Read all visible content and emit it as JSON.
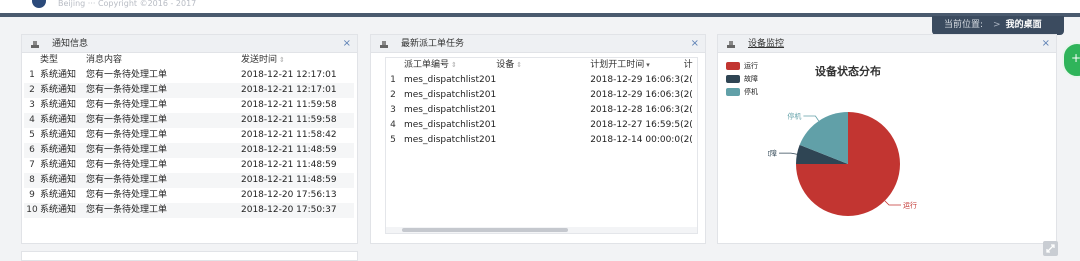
{
  "header": {
    "copyright": "Beijing ··· Copyright ©2016 - 2017",
    "breadcrumb_label": "当前位置:",
    "breadcrumb_sep": ">",
    "breadcrumb_current": "我的桌面"
  },
  "notice": {
    "title": "通知信息",
    "close": "×",
    "columns": [
      "类型",
      "消息内容",
      "发送时间"
    ],
    "rows": [
      {
        "n": "1",
        "type": "系统通知",
        "msg": "您有一条待处理工单",
        "time": "2018-12-21 12:17:01"
      },
      {
        "n": "2",
        "type": "系统通知",
        "msg": "您有一条待处理工单",
        "time": "2018-12-21 12:17:01"
      },
      {
        "n": "3",
        "type": "系统通知",
        "msg": "您有一条待处理工单",
        "time": "2018-12-21 11:59:58"
      },
      {
        "n": "4",
        "type": "系统通知",
        "msg": "您有一条待处理工单",
        "time": "2018-12-21 11:59:58"
      },
      {
        "n": "5",
        "type": "系统通知",
        "msg": "您有一条待处理工单",
        "time": "2018-12-21 11:58:42"
      },
      {
        "n": "6",
        "type": "系统通知",
        "msg": "您有一条待处理工单",
        "time": "2018-12-21 11:48:59"
      },
      {
        "n": "7",
        "type": "系统通知",
        "msg": "您有一条待处理工单",
        "time": "2018-12-21 11:48:59"
      },
      {
        "n": "8",
        "type": "系统通知",
        "msg": "您有一条待处理工单",
        "time": "2018-12-21 11:48:59"
      },
      {
        "n": "9",
        "type": "系统通知",
        "msg": "您有一条待处理工单",
        "time": "2018-12-20 17:56:13"
      },
      {
        "n": "10",
        "type": "系统通知",
        "msg": "您有一条待处理工单",
        "time": "2018-12-20 17:50:37"
      }
    ]
  },
  "dispatch": {
    "title": "最新派工单任务",
    "close": "×",
    "columns": [
      "派工单编号",
      "设备",
      "计划开工时间",
      "计"
    ],
    "rows": [
      {
        "n": "1",
        "code": "mes_dispatchlist201",
        "device": "",
        "time": "2018-12-29 16:06:3(",
        "extra": "2("
      },
      {
        "n": "2",
        "code": "mes_dispatchlist201",
        "device": "",
        "time": "2018-12-29 16:06:3(",
        "extra": "2("
      },
      {
        "n": "3",
        "code": "mes_dispatchlist201",
        "device": "",
        "time": "2018-12-28 16:06:3(",
        "extra": "2("
      },
      {
        "n": "4",
        "code": "mes_dispatchlist201",
        "device": "",
        "time": "2018-12-27 16:59:5(",
        "extra": "2("
      },
      {
        "n": "5",
        "code": "mes_dispatchlist201",
        "device": "",
        "time": "2018-12-14 00:00:0(",
        "extra": "2("
      }
    ]
  },
  "monitor": {
    "title": "设备监控",
    "close": "×",
    "chart_title": "设备状态分布",
    "legend": [
      {
        "name": "运行",
        "color": "#c23531"
      },
      {
        "name": "故障",
        "color": "#2f4554"
      },
      {
        "name": "停机",
        "color": "#61a0a8"
      }
    ]
  },
  "chart_data": {
    "type": "pie",
    "title": "设备状态分布",
    "categories": [
      "运行",
      "故障",
      "停机"
    ],
    "values": [
      75,
      6,
      19
    ],
    "colors": [
      "#c23531",
      "#2f4554",
      "#61a0a8"
    ],
    "legend_position": "top-left"
  }
}
